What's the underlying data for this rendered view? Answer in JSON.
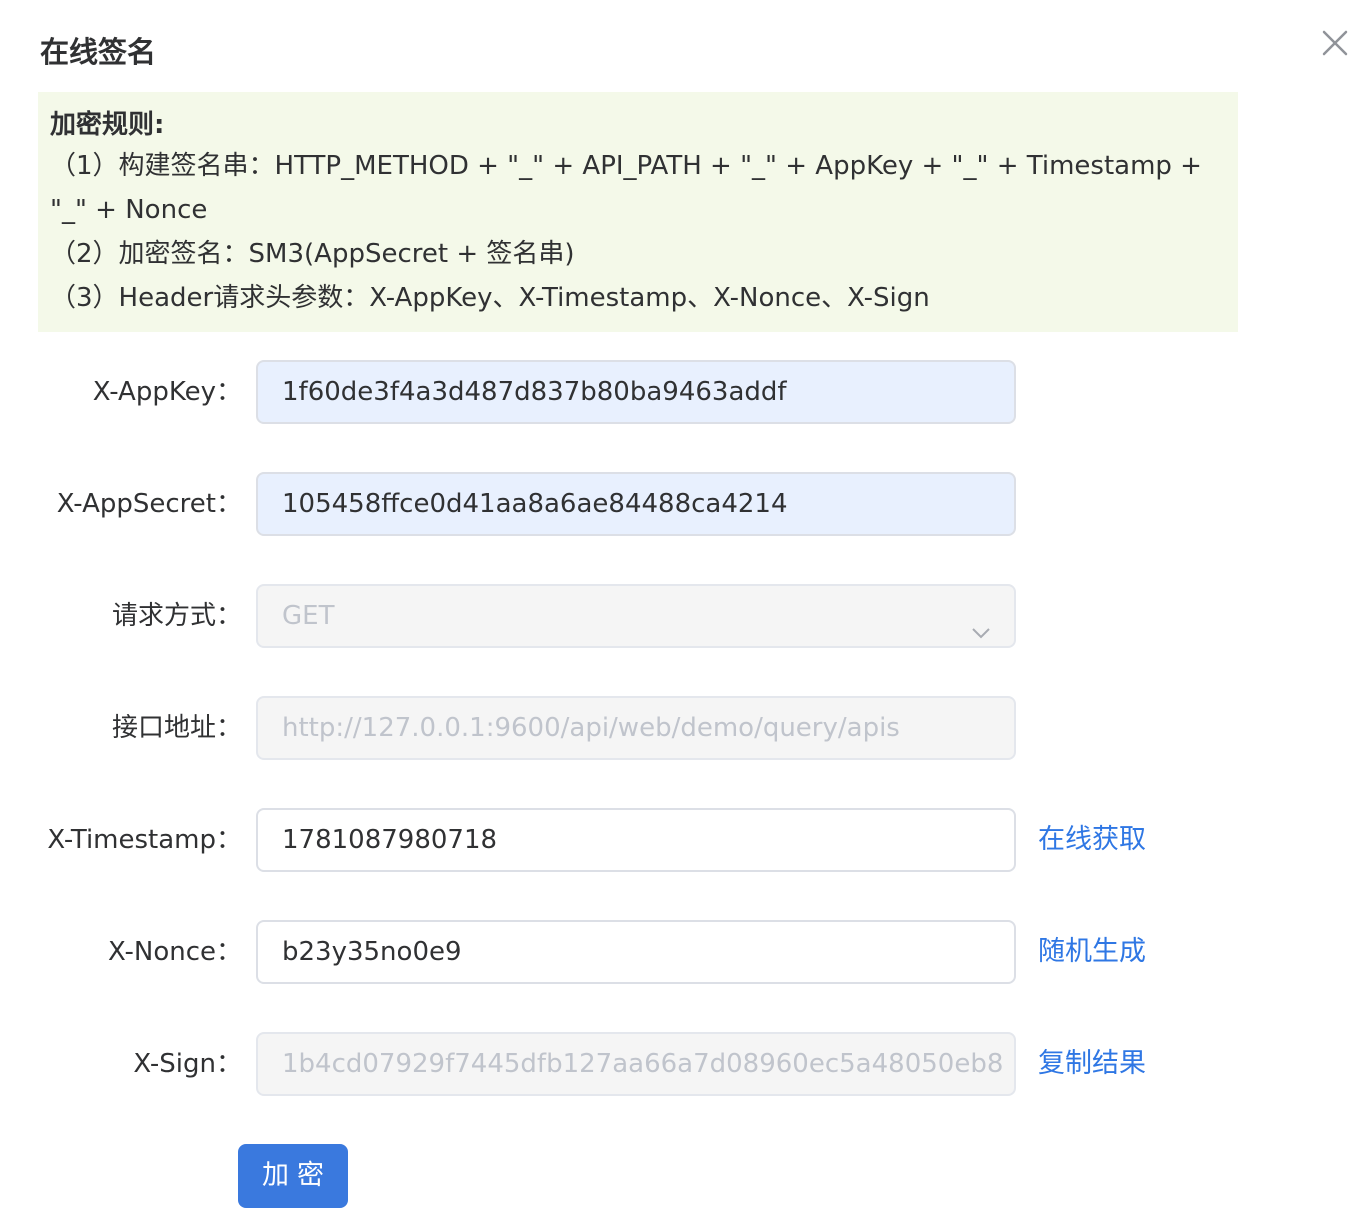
{
  "dialog": {
    "title": "在线签名",
    "close_icon": "close-icon"
  },
  "rules": {
    "title": "加密规则:",
    "line1a": "（1）构建签名串：HTTP_METHOD + \"_\" + API_PATH + \"_\" + AppKey + \"_\" + Timestamp +",
    "line1b": "\"_\" + Nonce",
    "line2": "（2）加密签名：SM3(AppSecret + 签名串)",
    "line3": "（3）Header请求头参数：X-AppKey、X-Timestamp、X-Nonce、X-Sign"
  },
  "form": {
    "appkey": {
      "label": "X-AppKey：",
      "value": "1f60de3f4a3d487d837b80ba9463addf"
    },
    "appsecret": {
      "label": "X-AppSecret：",
      "value": "105458ffce0d41aa8a6ae84488ca4214"
    },
    "method": {
      "label": "请求方式：",
      "value": "GET",
      "icon": "chevron-down-icon"
    },
    "url": {
      "label": "接口地址：",
      "value": "http://127.0.0.1:9600/api/web/demo/query/apis"
    },
    "timestamp": {
      "label": "X-Timestamp：",
      "value": "1781087980718",
      "action": "在线获取"
    },
    "nonce": {
      "label": "X-Nonce：",
      "value": "b23y35no0e9",
      "action": "随机生成"
    },
    "sign": {
      "label": "X-Sign：",
      "value": "1b4cd07929f7445dfb127aa66a7d08960ec5a48050eb8",
      "action": "复制结果"
    }
  },
  "submit_label": "加密",
  "colors": {
    "accent": "#3a79de",
    "link": "#2f77e4",
    "rules_bg": "#f4f9e9",
    "autofill_bg": "#e8f0fe"
  }
}
